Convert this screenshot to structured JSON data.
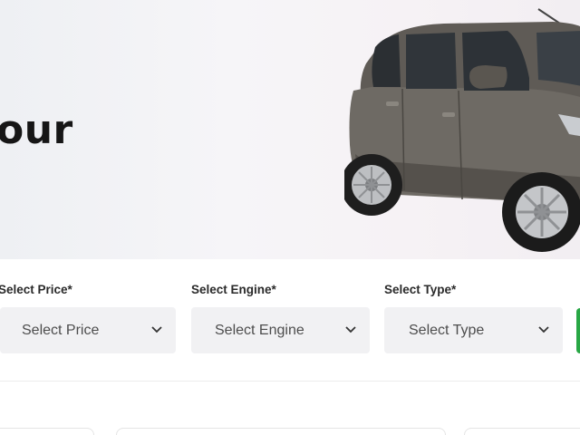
{
  "hero": {
    "title_fragment": "our"
  },
  "filters": [
    {
      "label": "Select Price*",
      "placeholder": "Select Price",
      "icon": "chevron-down-icon"
    },
    {
      "label": "Select Engine*",
      "placeholder": "Select Engine",
      "icon": "chevron-down-icon"
    },
    {
      "label": "Select Type*",
      "placeholder": "Select Type",
      "icon": "chevron-down-icon"
    }
  ],
  "colors": {
    "accent": "#28a745",
    "select_bg": "#f1f1f3",
    "car_body": "#6e6a64"
  }
}
